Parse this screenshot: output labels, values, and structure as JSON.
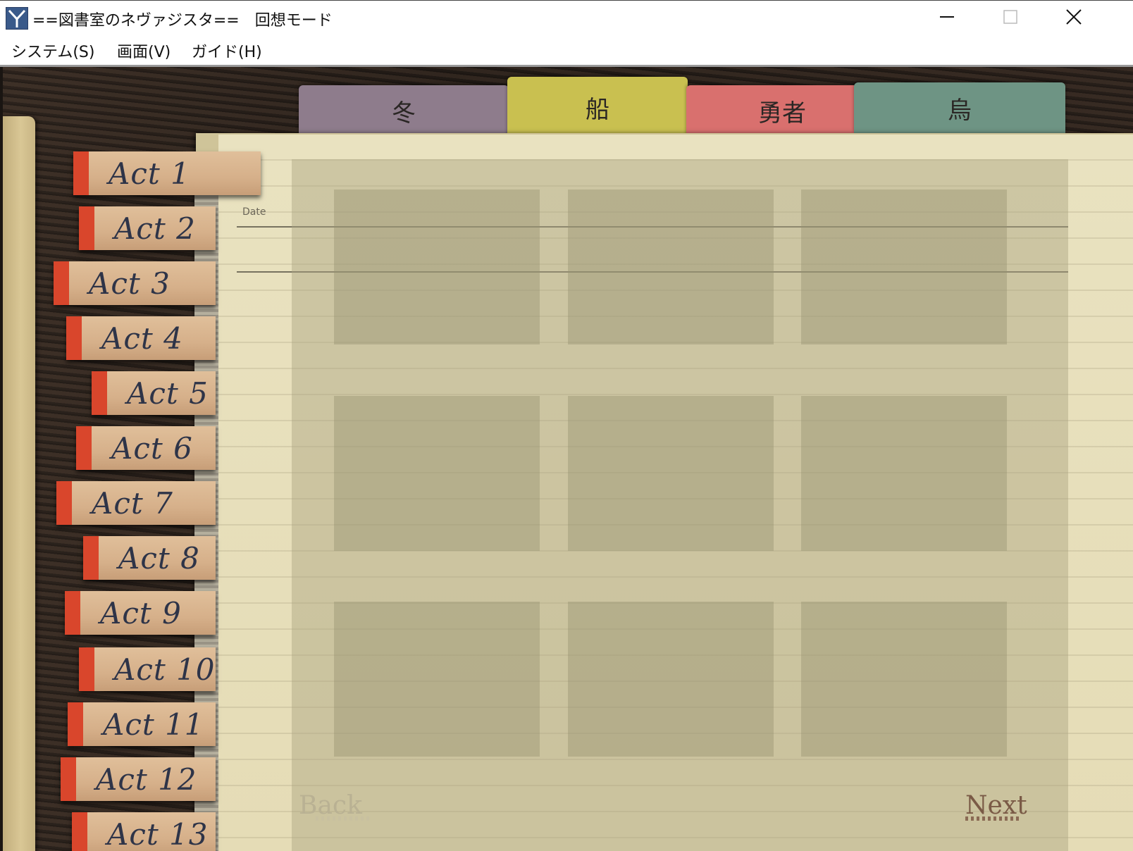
{
  "window": {
    "title": "==図書室のネヴァジスタ==　回想モード",
    "controls": [
      "minimize-icon",
      "maximize-icon",
      "close-icon"
    ]
  },
  "menu": [
    {
      "label": "システム(S)"
    },
    {
      "label": "画面(V)"
    },
    {
      "label": "ガイド(H)"
    }
  ],
  "character_tabs": [
    {
      "label": "冬",
      "color": "#8e7c8c"
    },
    {
      "label": "船",
      "color": "#c9c050"
    },
    {
      "label": "勇者",
      "color": "#d9706e"
    },
    {
      "label": "烏",
      "color": "#6e9484"
    }
  ],
  "act_tabs": [
    {
      "label": "Act 1"
    },
    {
      "label": "Act 2"
    },
    {
      "label": "Act 3"
    },
    {
      "label": "Act 4"
    },
    {
      "label": "Act 5"
    },
    {
      "label": "Act 6"
    },
    {
      "label": "Act 7"
    },
    {
      "label": "Act 8"
    },
    {
      "label": "Act 9"
    },
    {
      "label": "Act 10"
    },
    {
      "label": "Act 11"
    },
    {
      "label": "Act 12"
    },
    {
      "label": "Act 13"
    }
  ],
  "page": {
    "date_label": "Date",
    "thumbnail_count": 9,
    "back_label": "Back",
    "next_label": "Next"
  },
  "colors": {
    "act_tab_edge": "#d9462c",
    "paper": "#e9e2c0",
    "wood": "#2b221c"
  }
}
